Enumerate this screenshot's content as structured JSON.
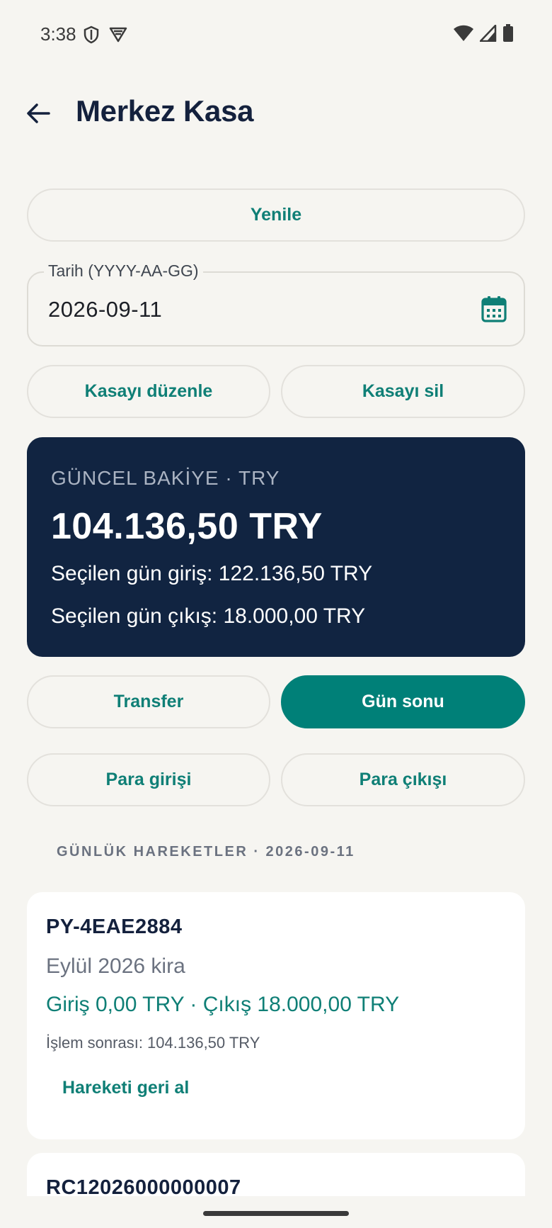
{
  "status_bar": {
    "time": "3:38"
  },
  "header": {
    "title": "Merkez Kasa"
  },
  "actions": {
    "refresh_label": "Yenile",
    "edit_label": "Kasayı düzenle",
    "delete_label": "Kasayı sil",
    "transfer_label": "Transfer",
    "day_end_label": "Gün sonu",
    "cash_in_label": "Para girişi",
    "cash_out_label": "Para çıkışı"
  },
  "date_field": {
    "label": "Tarih (YYYY-AA-GG)",
    "value": "2026-09-11"
  },
  "balance": {
    "caption": "GÜNCEL BAKİYE · TRY",
    "amount": "104.136,50 TRY",
    "selected_in": "Seçilen gün giriş: 122.136,50 TRY",
    "selected_out": "Seçilen gün çıkış: 18.000,00 TRY"
  },
  "movements": {
    "header": "GÜNLÜK HAREKETLER · 2026-09-11",
    "items": [
      {
        "ref": "PY-4EAE2884",
        "description": "Eylül 2026 kira",
        "amounts": "Giriş 0,00 TRY · Çıkış 18.000,00 TRY",
        "after": "İşlem sonrası: 104.136,50 TRY",
        "action": "Hareketi geri al"
      },
      {
        "ref": "RC12026000000007"
      }
    ]
  },
  "colors": {
    "accent": "#0f7f76",
    "primary_button": "#008078",
    "card_dark": "#112441",
    "background": "#f6f5f1"
  }
}
